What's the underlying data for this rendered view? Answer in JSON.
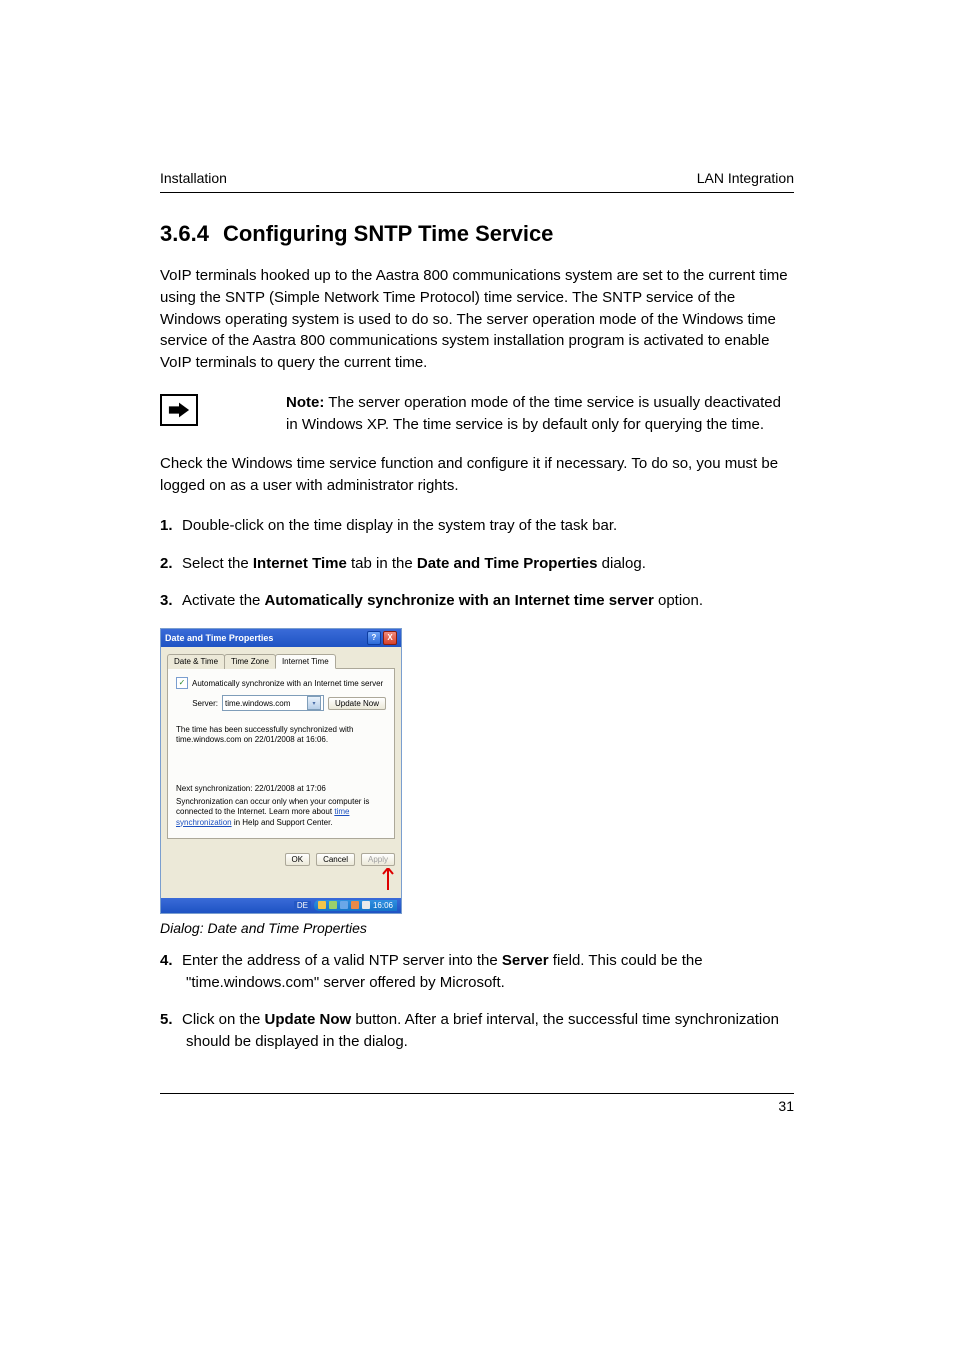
{
  "header": {
    "left": "Installation",
    "right": "LAN Integration"
  },
  "section": {
    "number": "3.6.4",
    "title": "Configuring SNTP Time Service"
  },
  "intro": "VoIP terminals hooked up to the Aastra 800 communications system are set to the current time using the SNTP (Simple Network Time Protocol) time service. The SNTP service of the Windows operating system is used to do so. The server operation mode of the Windows time service of the Aastra 800 communications system installation program is activated to enable VoIP terminals to query the current time.",
  "note": {
    "label": "Note:",
    "text": "The server operation mode of the time service is usually deactivated in Windows XP. The time service is by default only for querying the time."
  },
  "para_check": "Check the Windows time service function and configure it if necessary. To do so, you must be logged on as a user with administrator rights.",
  "steps": {
    "s1": {
      "num": "1.",
      "text": "Double-click on the time display in the system tray of the task bar."
    },
    "s2": {
      "num": "2.",
      "pre": "Select the ",
      "b1": "Internet Time",
      "mid": " tab in the ",
      "b2": "Date and Time Properties",
      "post": " dialog."
    },
    "s3": {
      "num": "3.",
      "pre": "Activate the ",
      "b1": "Automatically synchronize with an Internet time server",
      "post": " option."
    },
    "s4": {
      "num": "4.",
      "pre": "Enter the address of a valid NTP server into the ",
      "b1": "Server",
      "post": " field. This could be the \"time.windows.com\" server offered by Microsoft."
    },
    "s5": {
      "num": "5.",
      "pre": "Click on the ",
      "b1": "Update Now",
      "post": " button. After a brief interval, the successful time synchronization should be displayed in the dialog."
    }
  },
  "dialog": {
    "title": "Date and Time Properties",
    "help": "?",
    "close": "X",
    "tabs": {
      "t1": "Date & Time",
      "t2": "Time Zone",
      "t3": "Internet Time"
    },
    "auto_label": "Automatically synchronize with an Internet time server",
    "server_label": "Server:",
    "server_value": "time.windows.com",
    "update_now": "Update Now",
    "sync_ok": "The time has been successfully synchronized with time.windows.com on 22/01/2008 at 16:06.",
    "next_sync": "Next synchronization: 22/01/2008 at 17:06",
    "sync_note_pre": "Synchronization can occur only when your computer is connected to the Internet. Learn more about ",
    "sync_link": "time synchronization",
    "sync_note_post": " in Help and Support Center.",
    "ok": "OK",
    "cancel": "Cancel",
    "apply": "Apply",
    "lang": "DE",
    "clock": "16:06"
  },
  "caption": "Dialog: Date and Time Properties",
  "page_number": "31"
}
